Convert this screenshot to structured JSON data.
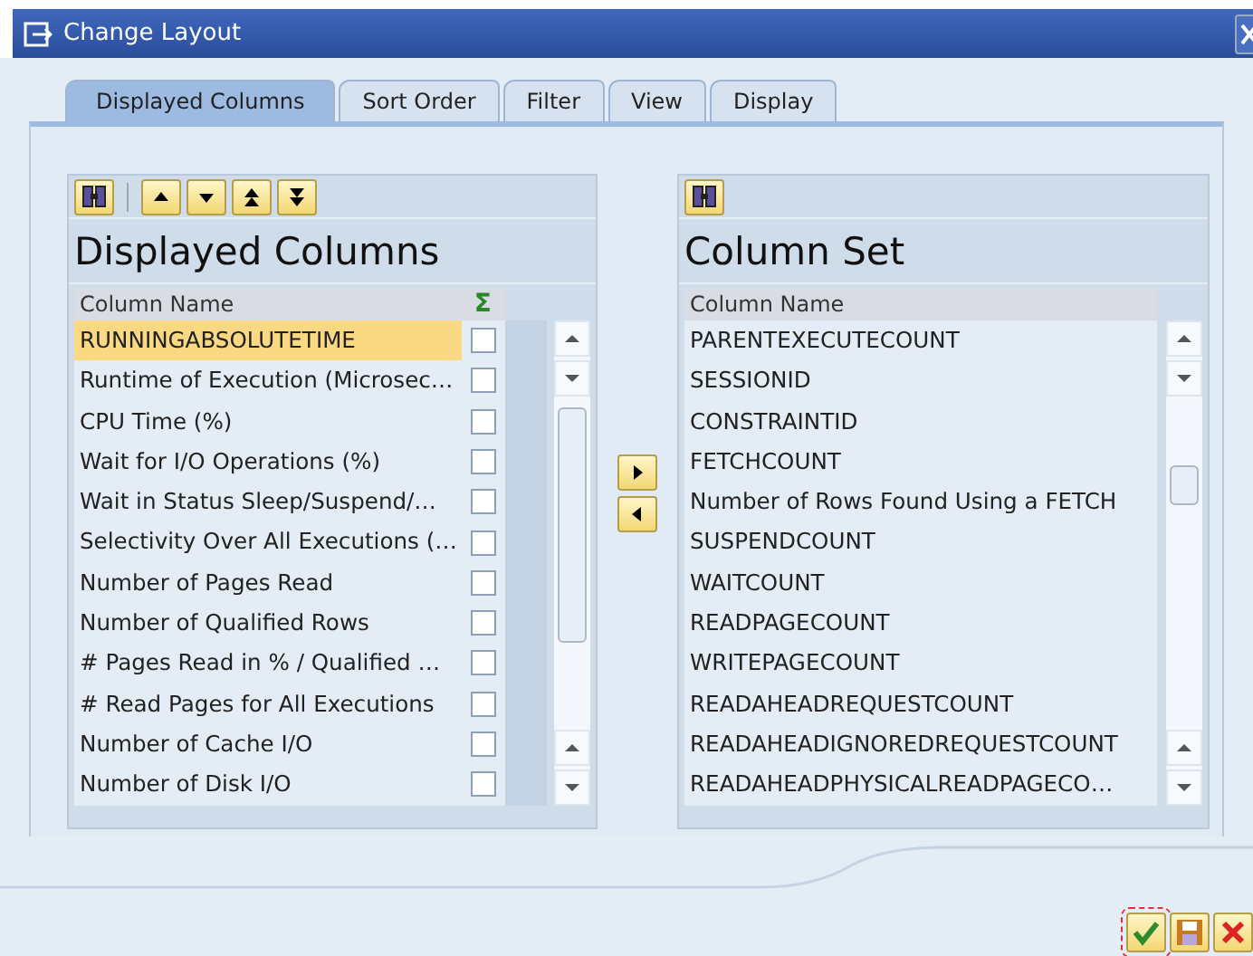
{
  "window": {
    "title": "Change Layout"
  },
  "tabs": [
    {
      "label": "Displayed Columns",
      "selected": true
    },
    {
      "label": "Sort Order",
      "selected": false
    },
    {
      "label": "Filter",
      "selected": false
    },
    {
      "label": "View",
      "selected": false
    },
    {
      "label": "Display",
      "selected": false
    }
  ],
  "displayed_columns": {
    "title": "Displayed Columns",
    "column_header": "Column Name",
    "sum_header": "Σ",
    "rows": [
      {
        "name": "RUNNINGABSOLUTETIME",
        "selected": true,
        "checked": false
      },
      {
        "name": "Runtime of Execution (Microsec…",
        "selected": false,
        "checked": false
      },
      {
        "name": "CPU Time (%)",
        "selected": false,
        "checked": false
      },
      {
        "name": "Wait for I/O Operations (%)",
        "selected": false,
        "checked": false
      },
      {
        "name": "Wait in Status Sleep/Suspend/…",
        "selected": false,
        "checked": false
      },
      {
        "name": "Selectivity Over All Executions (…",
        "selected": false,
        "checked": false
      },
      {
        "name": "Number of Pages Read",
        "selected": false,
        "checked": false
      },
      {
        "name": "Number of Qualified Rows",
        "selected": false,
        "checked": false
      },
      {
        "name": "# Pages Read in % / Qualified …",
        "selected": false,
        "checked": false
      },
      {
        "name": "# Read Pages for All Executions",
        "selected": false,
        "checked": false
      },
      {
        "name": "Number of Cache I/O",
        "selected": false,
        "checked": false
      },
      {
        "name": "Number of Disk I/O",
        "selected": false,
        "checked": false
      }
    ]
  },
  "column_set": {
    "title": "Column Set",
    "column_header": "Column Name",
    "rows": [
      {
        "name": "PARENTEXECUTECOUNT",
        "selected": false
      },
      {
        "name": "SESSIONID",
        "selected": false
      },
      {
        "name": "CONSTRAINTID",
        "selected": false
      },
      {
        "name": "FETCHCOUNT",
        "selected": false
      },
      {
        "name": "Number of Rows Found Using a FETCH",
        "selected": false
      },
      {
        "name": "SUSPENDCOUNT",
        "selected": false
      },
      {
        "name": "WAITCOUNT",
        "selected": false
      },
      {
        "name": "READPAGECOUNT",
        "selected": false
      },
      {
        "name": "WRITEPAGECOUNT",
        "selected": false
      },
      {
        "name": "READAHEADREQUESTCOUNT",
        "selected": false
      },
      {
        "name": "READAHEADIGNOREDREQUESTCOUNT",
        "selected": false
      },
      {
        "name": "READAHEADPHYSICALREADPAGECO…",
        "selected": false
      }
    ]
  }
}
